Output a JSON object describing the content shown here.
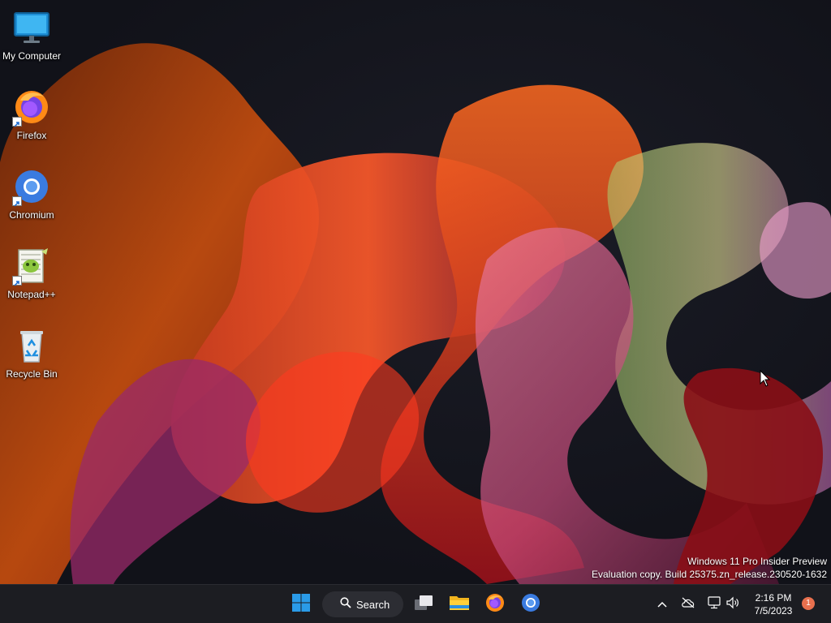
{
  "desktop_icons": [
    {
      "label": "My Computer",
      "icon": "monitor-icon",
      "shortcut": false
    },
    {
      "label": "Firefox",
      "icon": "firefox-icon",
      "shortcut": true
    },
    {
      "label": "Chromium",
      "icon": "chromium-icon",
      "shortcut": true
    },
    {
      "label": "Notepad++",
      "icon": "notepad-plus-plus-icon",
      "shortcut": true
    },
    {
      "label": "Recycle Bin",
      "icon": "recycle-bin-icon",
      "shortcut": false
    }
  ],
  "watermark": {
    "line1": "Windows 11 Pro Insider Preview",
    "line2": "Evaluation copy. Build 25375.zn_release.230520-1632"
  },
  "taskbar": {
    "search_label": "Search",
    "pinned": [
      {
        "name": "start",
        "icon": "windows-logo-icon"
      },
      {
        "name": "task-view",
        "icon": "task-view-icon"
      },
      {
        "name": "file-explorer",
        "icon": "folder-icon"
      },
      {
        "name": "firefox",
        "icon": "firefox-icon"
      },
      {
        "name": "chromium",
        "icon": "chromium-icon"
      }
    ],
    "tray": {
      "overflow_icon": "chevron-up-icon",
      "icons": [
        "onedrive-offline-icon",
        "network-icon",
        "volume-icon"
      ]
    },
    "clock": {
      "time": "2:16 PM",
      "date": "7/5/2023"
    },
    "notification_count": "1"
  },
  "colors": {
    "taskbar_bg": "#1c1d22",
    "accent_orange": "#e8704e",
    "start_blue": "#2a9be8"
  }
}
